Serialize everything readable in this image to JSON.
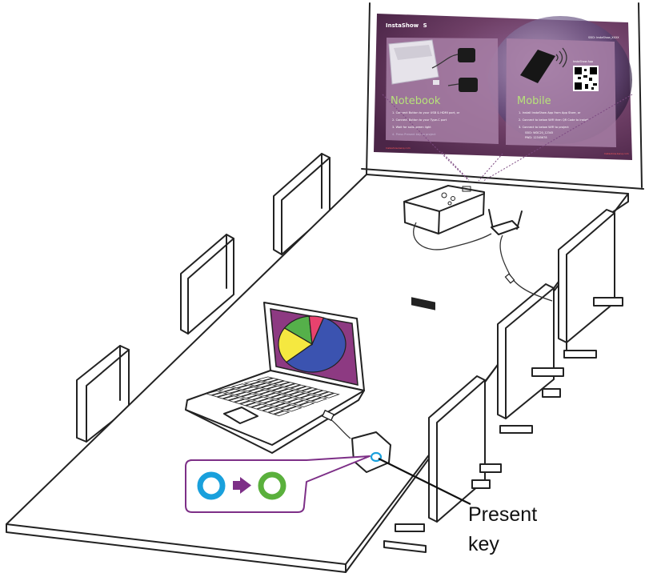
{
  "projection_screen": {
    "title": "InstaShow",
    "title_suffix": "S",
    "top_right_note": "SSID: InstaShow_XXXX",
    "colors": {
      "background": "#7a4a6e",
      "panel": "#a77fa6",
      "heading": "#b7e27a"
    },
    "notebook_panel": {
      "heading": "Notebook",
      "steps": [
        "1. Connect Button to your USB & HDMI port, or",
        "2. Connect Button to your Type-C port",
        "3. Wait for solid green light",
        "4. Press Present key to project"
      ]
    },
    "mobile_panel": {
      "heading": "Mobile",
      "app_label": "InstaShow App",
      "steps": [
        "1. Install InstaShow App from App Store, or",
        "2. Connect to below WiFi then QR Code to install",
        "3. Connect to below WiFi to project"
      ],
      "wifi": [
        "SSID: WDC20_12345",
        "PWD: 12345678"
      ]
    },
    "footer_left": "Instashow.benq.com",
    "footer_right": "Instashow.benq.com"
  },
  "laptop": {
    "screen_color": "#8d3a82",
    "pie_colors": [
      "#3b53b0",
      "#f5e840",
      "#55b04a",
      "#e8426e"
    ]
  },
  "present_key": {
    "callout_line1": "Present",
    "callout_line2": "key",
    "states": [
      {
        "name": "before",
        "color": "#19a0dc"
      },
      {
        "name": "after",
        "color": "#5ab03c"
      }
    ],
    "arrow_color": "#7d2f87",
    "bubble_border": "#7d2f87"
  }
}
